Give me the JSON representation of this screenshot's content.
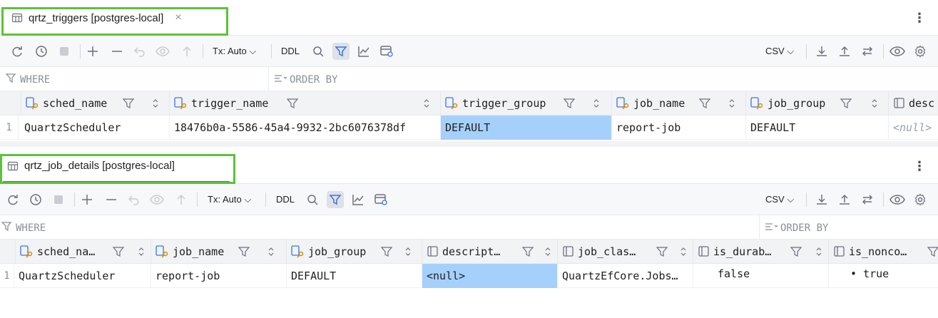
{
  "panels": [
    {
      "tab": {
        "title": "qrtz_triggers [postgres-local]",
        "close": "×",
        "icon": "table-icon"
      },
      "menu": "⋮",
      "toolbar": {
        "tx": "Tx: Auto",
        "ddl": "DDL",
        "csv": "CSV"
      },
      "filter": {
        "where": "WHERE",
        "order": "ORDER BY"
      },
      "columns": [
        {
          "name": "sched_name",
          "icon": "key-column-icon"
        },
        {
          "name": "trigger_name",
          "icon": "key-column-icon"
        },
        {
          "name": "trigger_group",
          "icon": "key-column-icon"
        },
        {
          "name": "job_name",
          "icon": "key-column-icon"
        },
        {
          "name": "job_group",
          "icon": "key-column-icon"
        },
        {
          "name": "desc",
          "icon": "column-icon"
        }
      ],
      "rows": [
        {
          "num": "1",
          "cells": [
            "QuartzScheduler",
            "18476b0a-5586-45a4-9932-2bc6076378df",
            "DEFAULT",
            "report-job",
            "DEFAULT",
            "<null>"
          ]
        }
      ]
    },
    {
      "tab": {
        "title": "qrtz_job_details [postgres-local]",
        "icon": "table-icon"
      },
      "menu": "⋮",
      "toolbar": {
        "tx": "Tx: Auto",
        "ddl": "DDL",
        "csv": "CSV"
      },
      "filter": {
        "where": "WHERE",
        "order": "ORDER BY"
      },
      "columns": [
        {
          "name": "sched_na…",
          "icon": "key-column-icon"
        },
        {
          "name": "job_name",
          "icon": "key-column-icon"
        },
        {
          "name": "job_group",
          "icon": "key-column-icon"
        },
        {
          "name": "descript…",
          "icon": "column-icon"
        },
        {
          "name": "job_clas…",
          "icon": "column-icon"
        },
        {
          "name": "is_durab…",
          "icon": "column-icon"
        },
        {
          "name": "is_nonco…",
          "icon": "column-icon"
        }
      ],
      "rows": [
        {
          "num": "1",
          "cells": [
            "QuartzScheduler",
            "report-job",
            "DEFAULT",
            "<null>",
            "QuartzEfCore.Jobs…",
            "false",
            "• true"
          ]
        }
      ]
    }
  ],
  "colors": {
    "highlight": "#5cc23a",
    "selection": "#a6d0fc",
    "accent": "#3574f0"
  }
}
